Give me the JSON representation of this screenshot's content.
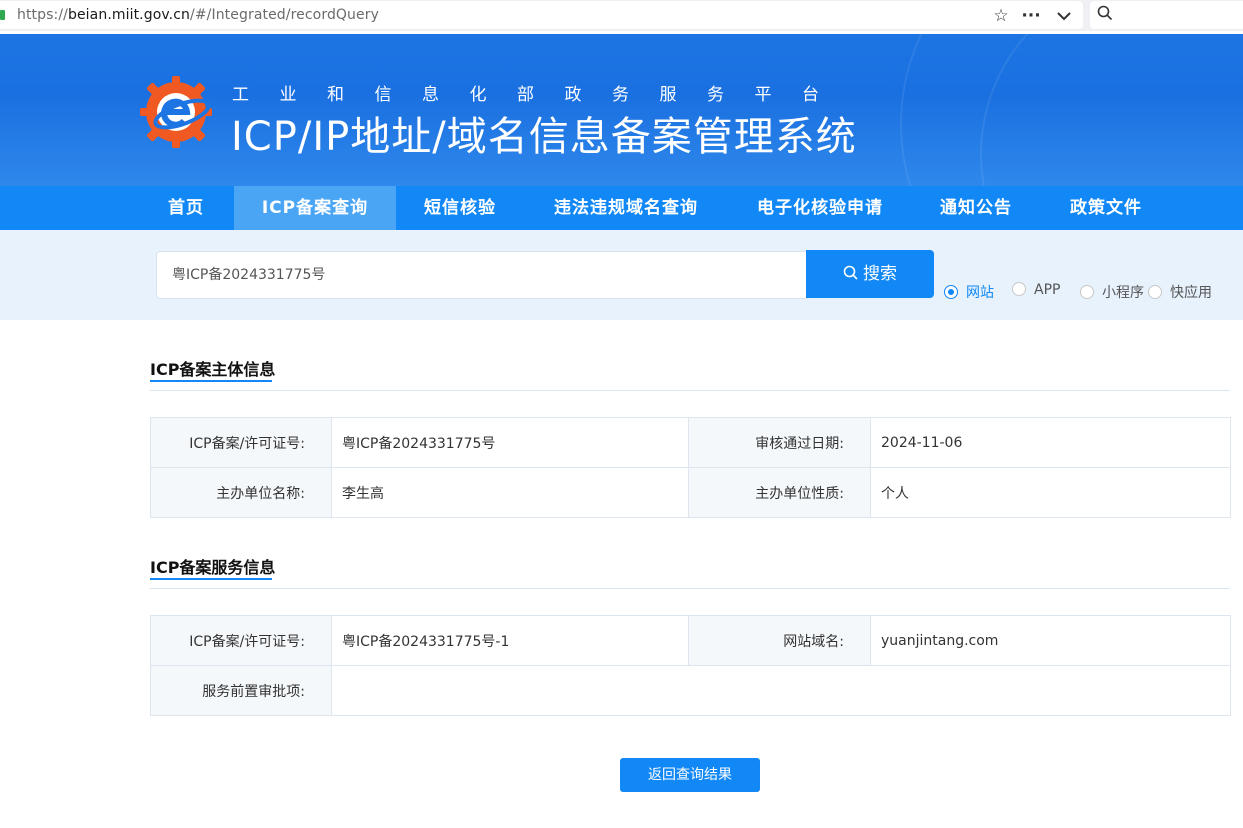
{
  "browser": {
    "url_prefix": "https://",
    "url_host": "beian.miit.gov.cn",
    "url_path": "/#/Integrated/recordQuery",
    "icons": [
      "star-icon",
      "more-icon",
      "chevron-down-icon",
      "search-icon"
    ]
  },
  "header": {
    "subtitle": "工业和信息化部政务服务平台",
    "title": "ICP/IP地址/域名信息备案管理系统",
    "logo_color": "#f05a22"
  },
  "nav": {
    "items": [
      {
        "label": "首页",
        "active": false
      },
      {
        "label": "ICP备案查询",
        "active": true
      },
      {
        "label": "短信核验",
        "active": false
      },
      {
        "label": "违法违规域名查询",
        "active": false
      },
      {
        "label": "电子化核验申请",
        "active": false
      },
      {
        "label": "通知公告",
        "active": false
      },
      {
        "label": "政策文件",
        "active": false
      }
    ]
  },
  "search": {
    "value": "粤ICP备2024331775号",
    "button_label": "搜索",
    "options": [
      {
        "label": "网站",
        "checked": true
      },
      {
        "label": "APP",
        "checked": false
      },
      {
        "label": "小程序",
        "checked": false
      },
      {
        "label": "快应用",
        "checked": false
      }
    ]
  },
  "subject_info": {
    "title": "ICP备案主体信息",
    "license_label": "ICP备案/许可证号:",
    "license_value": "粤ICP备2024331775号",
    "approve_date_label": "审核通过日期:",
    "approve_date_value": "2024-11-06",
    "org_name_label": "主办单位名称:",
    "org_name_value": "李生高",
    "org_type_label": "主办单位性质:",
    "org_type_value": "个人"
  },
  "service_info": {
    "title": "ICP备案服务信息",
    "license_label": "ICP备案/许可证号:",
    "license_value": "粤ICP备2024331775号-1",
    "domain_label": "网站域名:",
    "domain_value": "yuanjintang.com",
    "preapproval_label": "服务前置审批项:",
    "preapproval_value": ""
  },
  "back_button": "返回查询结果",
  "colors": {
    "primary": "#1188f5",
    "banner": "#1d74e3",
    "search_band": "#e7f2fd"
  }
}
